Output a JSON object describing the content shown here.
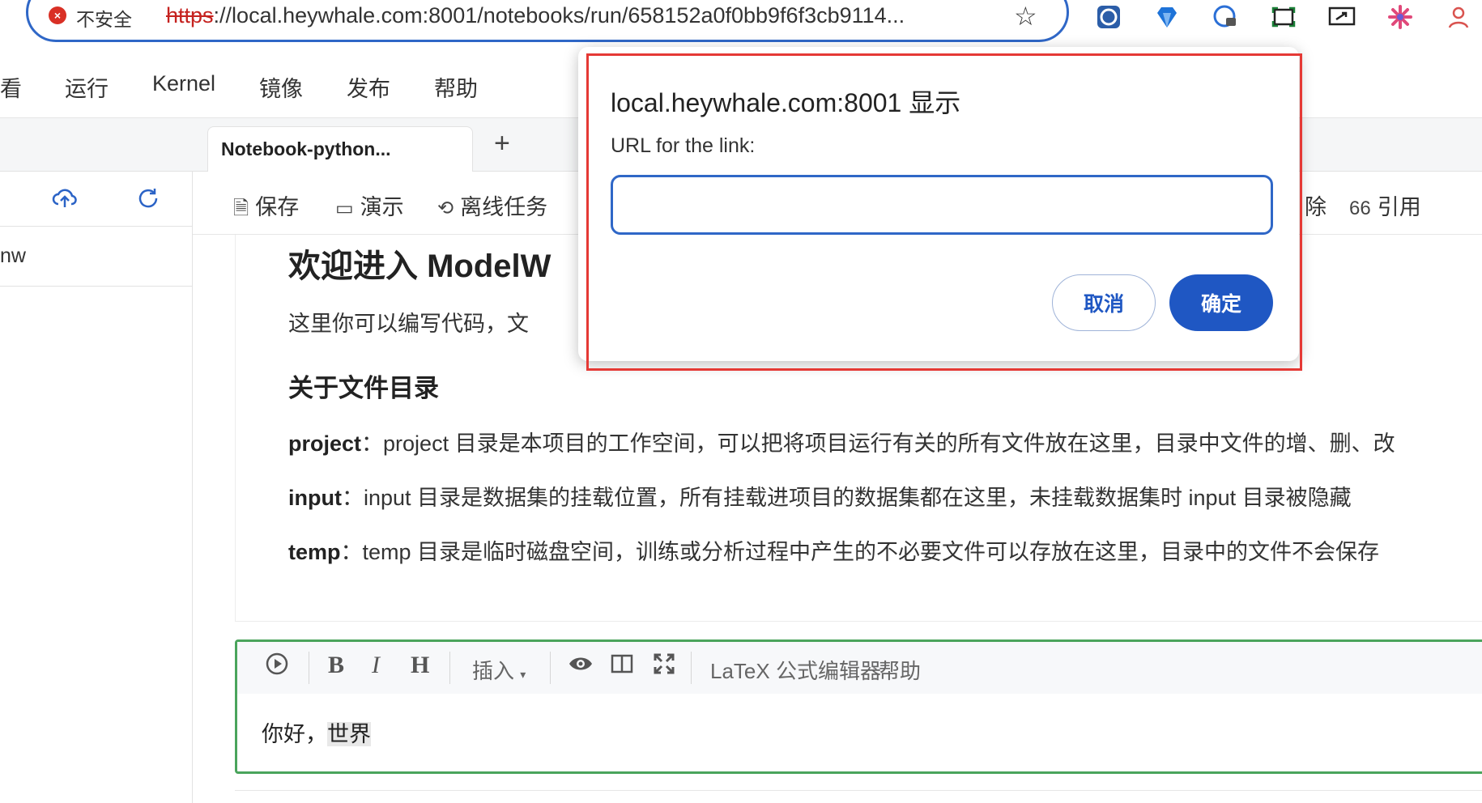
{
  "browser": {
    "security_label": "不安全",
    "url_scheme": "https",
    "url_rest": "://local.heywhale.com:8001/notebooks/run/658152a0f0bb9f6f3cb9114...",
    "bookmark_icon": "star-icon",
    "extensions": [
      "extension-circle-icon",
      "extension-diamond-icon",
      "extension-lock-icon",
      "screen-capture-icon",
      "screen-share-icon",
      "extension-spark-icon",
      "extension-person-icon"
    ]
  },
  "menubar": {
    "items": [
      "看",
      "运行",
      "Kernel",
      "镜像",
      "发布",
      "帮助"
    ]
  },
  "sidebar": {
    "file_label": "nw"
  },
  "tabs": {
    "active": "Notebook-python...",
    "add": "+"
  },
  "toolbar": {
    "save": "保存",
    "present": "演示",
    "offline": "离线任务",
    "delete_partial": "除",
    "cite": "引用",
    "cite_icon": "66"
  },
  "notebook": {
    "heading": "欢迎进入 ModelW",
    "intro": "这里你可以编写代码，文",
    "section_title": "关于文件目录",
    "paragraphs": [
      {
        "key": "project",
        "text": "：project 目录是本项目的工作空间，可以把将项目运行有关的所有文件放在这里，目录中文件的增、删、改"
      },
      {
        "key": "input",
        "text": "：input 目录是数据集的挂载位置，所有挂载进项目的数据集都在这里，未挂载数据集时 input 目录被隐藏"
      },
      {
        "key": "temp",
        "text": "：temp 目录是临时磁盘空间，训练或分析过程中产生的不必要文件可以存放在这里，目录中的文件不会保存"
      }
    ]
  },
  "editor": {
    "bold": "B",
    "italic": "I",
    "heading": "H",
    "insert": "插入",
    "latex": "LaTeX 公式编辑器",
    "help": "帮助",
    "text_plain": "你好，",
    "text_selected": "世界"
  },
  "dialog": {
    "title": "local.heywhale.com:8001 显示",
    "label": "URL for the link:",
    "input_value": "",
    "cancel": "取消",
    "ok": "确定"
  }
}
